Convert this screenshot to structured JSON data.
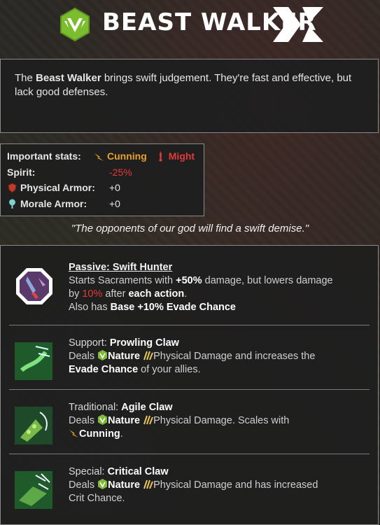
{
  "header": {
    "title": "Beast Walker"
  },
  "description": {
    "prefix": "The ",
    "class_name": "Beast Walker",
    "rest": " brings swift judgement. They're fast and effective, but lack good defenses."
  },
  "stats": {
    "important_label": "Important stats:",
    "important_1": "Cunning",
    "important_2": "Might",
    "spirit_label": "Spirit:",
    "spirit_value": "-25%",
    "physical_label": "Physical Armor:",
    "physical_value": "+0",
    "morale_label": "Morale Armor:",
    "morale_value": "+0"
  },
  "quote": "\"The opponents of our god will find a swift demise.\"",
  "skills": [
    {
      "type": "Passive: Swift Hunter",
      "line1_pre": "Starts Sacraments with ",
      "line1_bold": "+50%",
      "line1_post": " damage, but lowers damage",
      "line2_pre": "by ",
      "line2_red": "10%",
      "line2_mid": " after ",
      "line2_bold": "each action",
      "line2_post": ".",
      "line3_pre": "Also has ",
      "line3_bold": "Base +10% Evade Chance"
    },
    {
      "type": "Support: ",
      "name": "Prowling Claw",
      "deals": "Deals ",
      "element": "Nature",
      "text": "Physical Damage and increases the",
      "line2_bold": "Evade Chance",
      "line2_post": " of your allies."
    },
    {
      "type": "Traditional: ",
      "name": "Agile Claw",
      "deals": "Deals ",
      "element": "Nature",
      "text": "Physical Damage. Scales with",
      "line2_bold": "Cunning",
      "line2_post": "."
    },
    {
      "type": "Special: ",
      "name": "Critical Claw",
      "deals": "Deals ",
      "element": "Nature",
      "text": "Physical Damage and has increased",
      "line2": "Crit Chance."
    }
  ],
  "colors": {
    "cunning": "#e8a12e",
    "might": "#e03a3a",
    "nature": "#7fb93a",
    "panel_border": "#8a8a8a"
  },
  "icons": [
    "beast-walker-class-icon",
    "brand-x-logo",
    "cunning-icon",
    "might-icon",
    "physical-armor-icon",
    "morale-armor-icon",
    "nature-icon",
    "physical-damage-icon"
  ]
}
